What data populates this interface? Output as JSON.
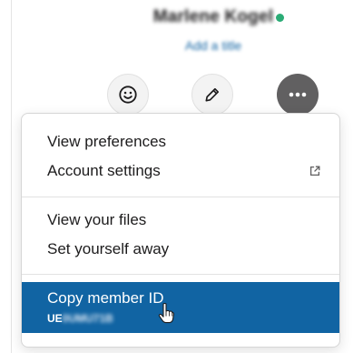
{
  "profile": {
    "name": "Marlene Kogel",
    "title_link": "Add a title",
    "status_color": "#2bac76"
  },
  "actions": {
    "emoji_icon": "smiley-face-icon",
    "edit_icon": "pencil-icon",
    "more_icon": "ellipsis-icon"
  },
  "menu": {
    "items": [
      {
        "label": "View preferences"
      },
      {
        "label": "Account settings",
        "icon": "external-link-icon"
      },
      {
        "label": "View your files"
      },
      {
        "label": "Set yourself away"
      }
    ],
    "copy_member_id": {
      "label": "Copy member ID",
      "id_prefix": "UE",
      "id_rest": "0UMU71B"
    }
  },
  "colors": {
    "highlight": "#1164a3",
    "more_button": "#616061",
    "link": "#1264a3"
  }
}
